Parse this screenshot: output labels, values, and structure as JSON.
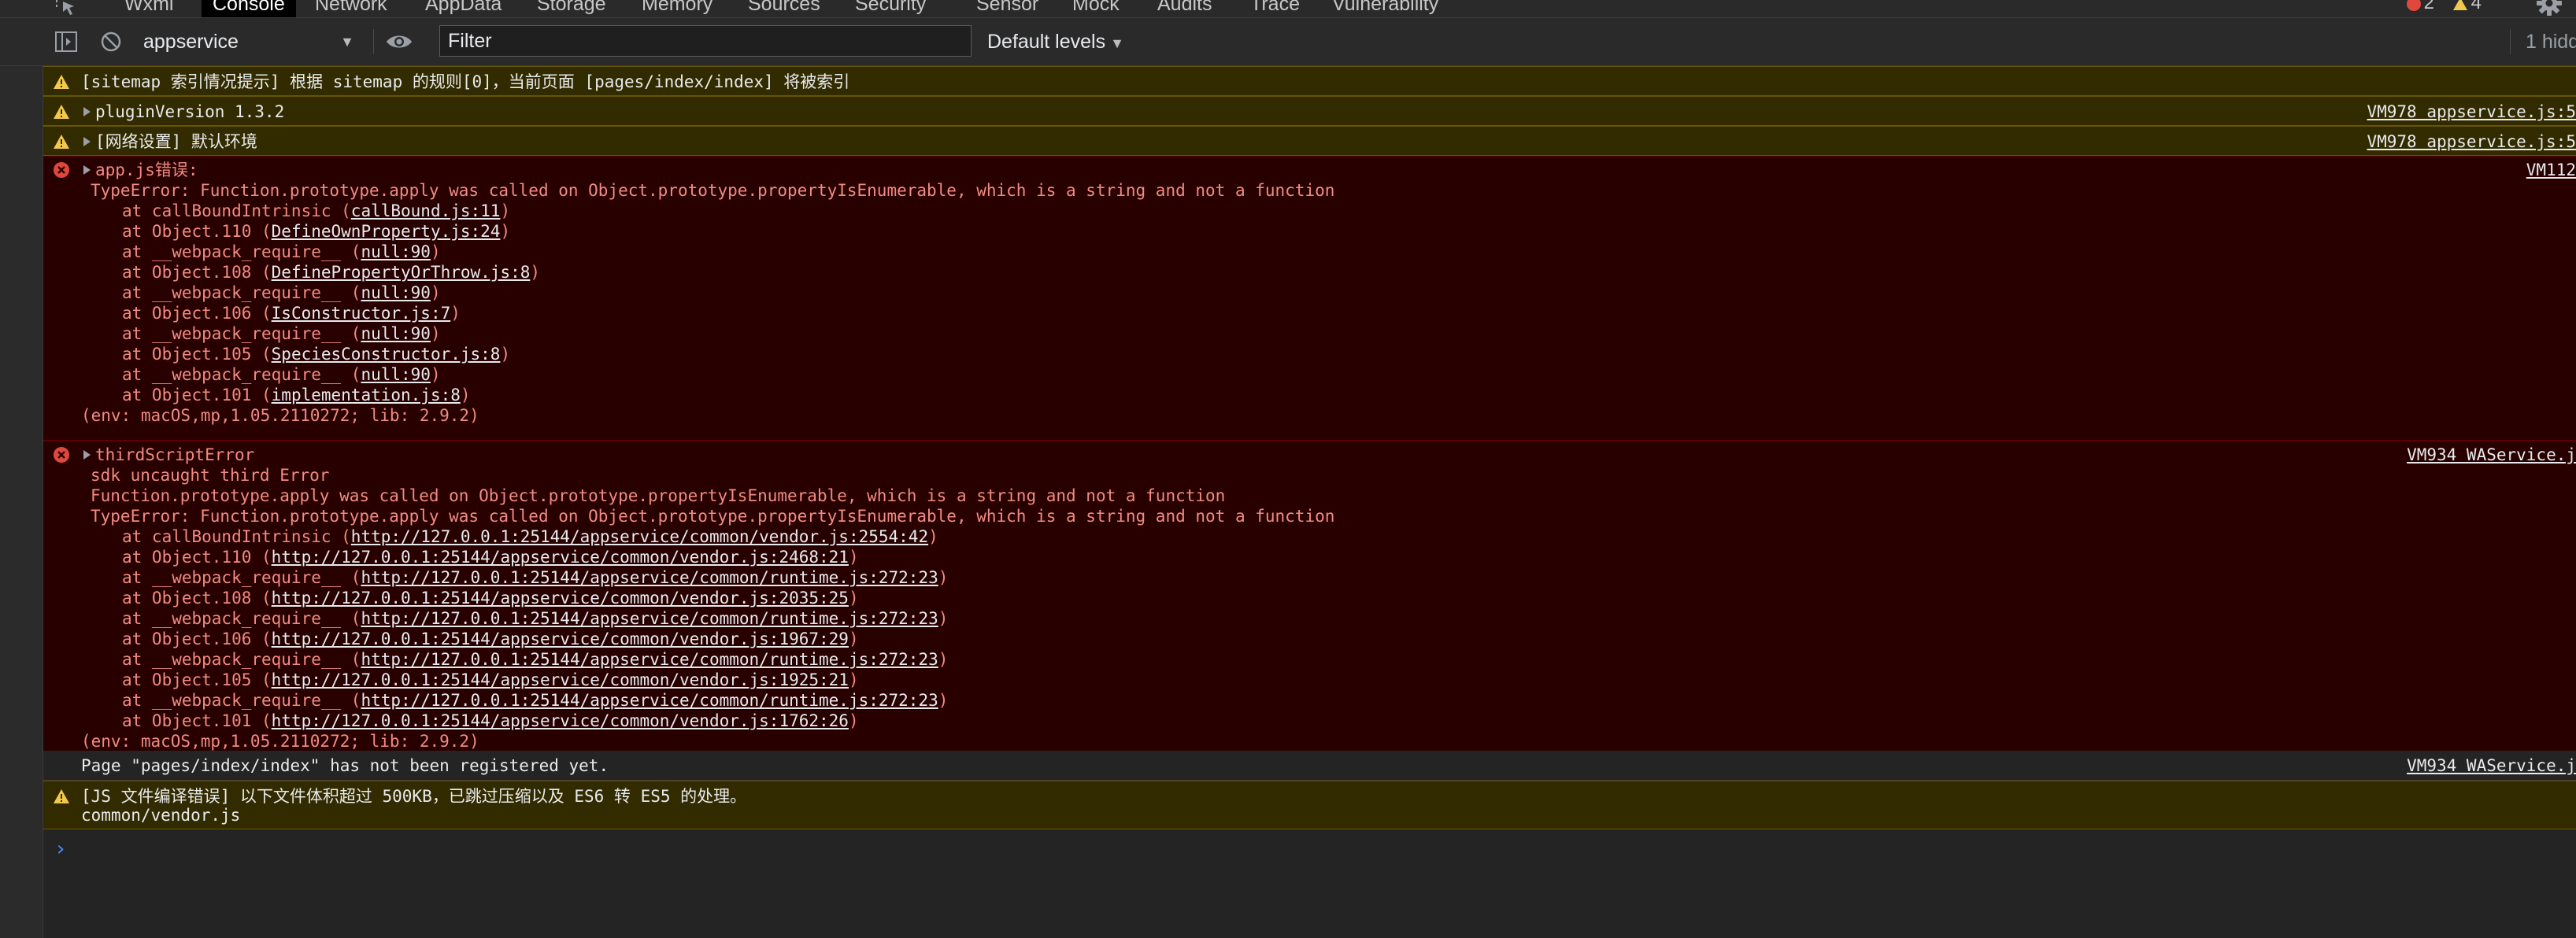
{
  "tabs": [
    {
      "label": "Wxml",
      "active": false
    },
    {
      "label": "Console",
      "active": true
    },
    {
      "label": "Network",
      "active": false
    },
    {
      "label": "AppData",
      "active": false
    },
    {
      "label": "Storage",
      "active": false
    },
    {
      "label": "Memory",
      "active": false
    },
    {
      "label": "Sources",
      "active": false
    },
    {
      "label": "Security",
      "active": false
    },
    {
      "label": "Sensor",
      "active": false
    },
    {
      "label": "Mock",
      "active": false
    },
    {
      "label": "Audits",
      "active": false
    },
    {
      "label": "Trace",
      "active": false
    },
    {
      "label": "Vulnerability",
      "active": false
    }
  ],
  "counts": {
    "errors": "2",
    "warnings": "4"
  },
  "toolbar": {
    "context": "appservice",
    "filter_placeholder": "Filter",
    "levels": "Default levels",
    "hidden": "1 hidd"
  },
  "colors": {
    "warning_bg": "#332b00",
    "error_bg": "#280000",
    "error_text": "#f28b82",
    "prompt": "#4a8cff"
  },
  "messages": {
    "m1": {
      "level": "warning",
      "text": "[sitemap 索引情况提示] 根据 sitemap 的规则[0]，当前页面 [pages/index/index] 将被索引"
    },
    "m2": {
      "level": "warning",
      "text": "pluginVersion 1.3.2",
      "source": "VM978 appservice.js:5"
    },
    "m3": {
      "level": "warning",
      "text": "[网络设置] 默认环境",
      "source": "VM978 appservice.js:5"
    },
    "m4": {
      "level": "error",
      "title": "app.js错误:",
      "source": "VM112",
      "error": "TypeError: Function.prototype.apply was called on Object.prototype.propertyIsEnumerable, which is a string and not a function",
      "stack": [
        {
          "fn": "at callBoundIntrinsic (",
          "loc": "callBound.js:11",
          "end": ")"
        },
        {
          "fn": "at Object.110 (",
          "loc": "DefineOwnProperty.js:24",
          "end": ")"
        },
        {
          "fn": "at __webpack_require__ (",
          "loc": "null:90",
          "end": ")"
        },
        {
          "fn": "at Object.108 (",
          "loc": "DefinePropertyOrThrow.js:8",
          "end": ")"
        },
        {
          "fn": "at __webpack_require__ (",
          "loc": "null:90",
          "end": ")"
        },
        {
          "fn": "at Object.106 (",
          "loc": "IsConstructor.js:7",
          "end": ")"
        },
        {
          "fn": "at __webpack_require__ (",
          "loc": "null:90",
          "end": ")"
        },
        {
          "fn": "at Object.105 (",
          "loc": "SpeciesConstructor.js:8",
          "end": ")"
        },
        {
          "fn": "at __webpack_require__ (",
          "loc": "null:90",
          "end": ")"
        },
        {
          "fn": "at Object.101 (",
          "loc": "implementation.js:8",
          "end": ")"
        }
      ],
      "env": "(env: macOS,mp,1.05.2110272; lib: 2.9.2)"
    },
    "m5": {
      "level": "error",
      "title": "thirdScriptError",
      "source": "VM934 WAService.j",
      "line1": "sdk uncaught third Error",
      "line2": "Function.prototype.apply was called on Object.prototype.propertyIsEnumerable, which is a string and not a function",
      "error": "TypeError: Function.prototype.apply was called on Object.prototype.propertyIsEnumerable, which is a string and not a function",
      "stack": [
        {
          "fn": "at callBoundIntrinsic (",
          "loc": "http://127.0.0.1:25144/appservice/common/vendor.js:2554:42",
          "end": ")"
        },
        {
          "fn": "at Object.110 (",
          "loc": "http://127.0.0.1:25144/appservice/common/vendor.js:2468:21",
          "end": ")"
        },
        {
          "fn": "at __webpack_require__ (",
          "loc": "http://127.0.0.1:25144/appservice/common/runtime.js:272:23",
          "end": ")"
        },
        {
          "fn": "at Object.108 (",
          "loc": "http://127.0.0.1:25144/appservice/common/vendor.js:2035:25",
          "end": ")"
        },
        {
          "fn": "at __webpack_require__ (",
          "loc": "http://127.0.0.1:25144/appservice/common/runtime.js:272:23",
          "end": ")"
        },
        {
          "fn": "at Object.106 (",
          "loc": "http://127.0.0.1:25144/appservice/common/vendor.js:1967:29",
          "end": ")"
        },
        {
          "fn": "at __webpack_require__ (",
          "loc": "http://127.0.0.1:25144/appservice/common/runtime.js:272:23",
          "end": ")"
        },
        {
          "fn": "at Object.105 (",
          "loc": "http://127.0.0.1:25144/appservice/common/vendor.js:1925:21",
          "end": ")"
        },
        {
          "fn": "at __webpack_require__ (",
          "loc": "http://127.0.0.1:25144/appservice/common/runtime.js:272:23",
          "end": ")"
        },
        {
          "fn": "at Object.101 (",
          "loc": "http://127.0.0.1:25144/appservice/common/vendor.js:1762:26",
          "end": ")"
        }
      ],
      "env": "(env: macOS,mp,1.05.2110272; lib: 2.9.2)"
    },
    "m6": {
      "level": "info",
      "text": "Page \"pages/index/index\" has not been registered yet.",
      "source": "VM934 WAService.j"
    },
    "m7": {
      "level": "warning",
      "text": "[JS 文件编译错误] 以下文件体积超过 500KB，已跳过压缩以及 ES6 转 ES5 的处理。",
      "text2": "common/vendor.js"
    }
  },
  "prompt_symbol": "›"
}
